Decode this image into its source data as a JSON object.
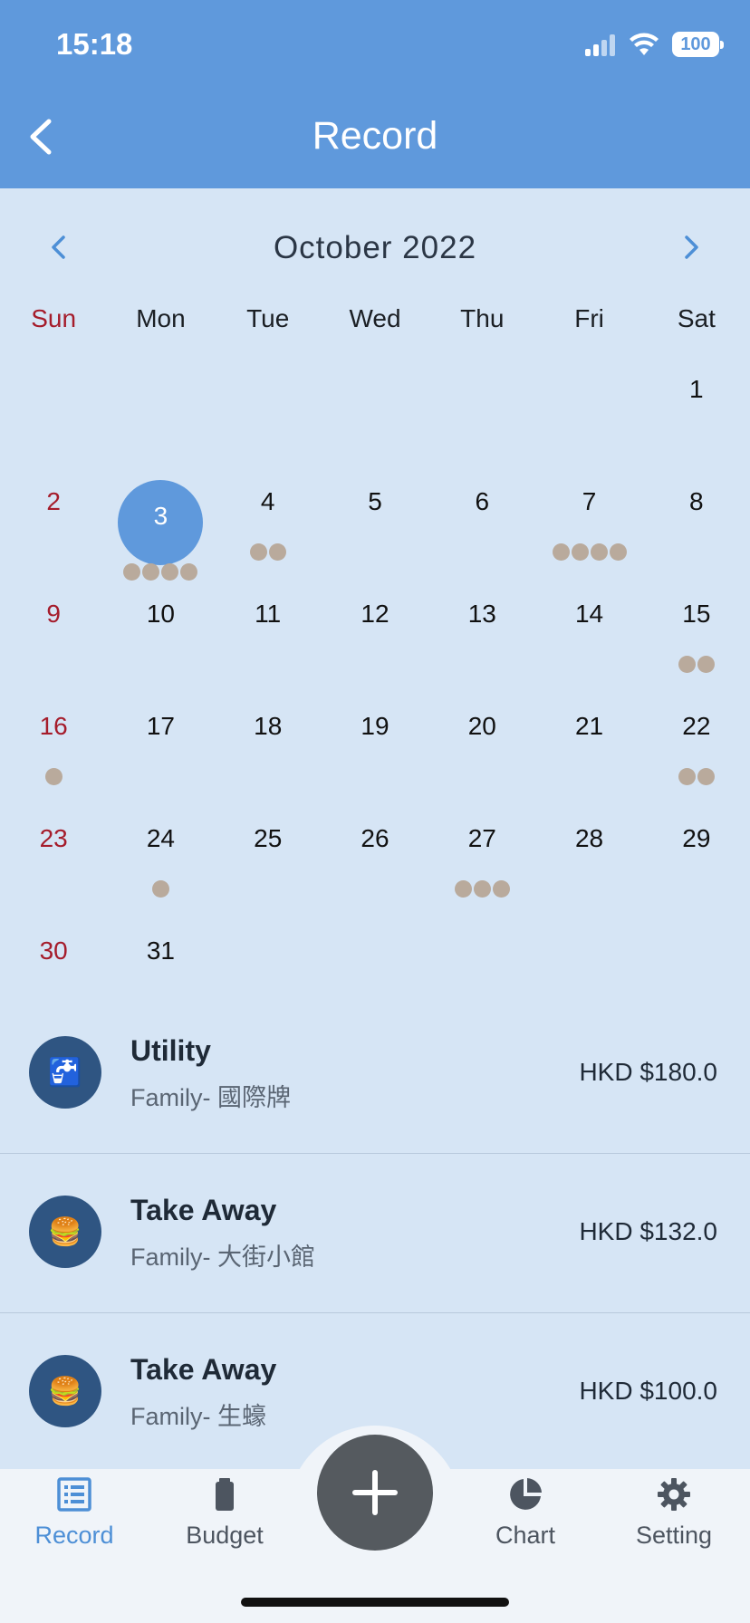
{
  "status_bar": {
    "time": "15:18",
    "battery": "100"
  },
  "header": {
    "title": "Record"
  },
  "calendar": {
    "month_title": "October 2022",
    "weekdays": [
      "Sun",
      "Mon",
      "Tue",
      "Wed",
      "Thu",
      "Fri",
      "Sat"
    ],
    "days": [
      {
        "d": ""
      },
      {
        "d": ""
      },
      {
        "d": ""
      },
      {
        "d": ""
      },
      {
        "d": ""
      },
      {
        "d": ""
      },
      {
        "d": "1"
      },
      {
        "d": "2"
      },
      {
        "d": "3",
        "selected": true,
        "dots": 4
      },
      {
        "d": "4",
        "dots": 2
      },
      {
        "d": "5"
      },
      {
        "d": "6"
      },
      {
        "d": "7",
        "dots": 4
      },
      {
        "d": "8"
      },
      {
        "d": "9"
      },
      {
        "d": "10"
      },
      {
        "d": "11"
      },
      {
        "d": "12"
      },
      {
        "d": "13"
      },
      {
        "d": "14"
      },
      {
        "d": "15",
        "dots": 2
      },
      {
        "d": "16",
        "dots": 1
      },
      {
        "d": "17"
      },
      {
        "d": "18"
      },
      {
        "d": "19"
      },
      {
        "d": "20"
      },
      {
        "d": "21"
      },
      {
        "d": "22",
        "dots": 2
      },
      {
        "d": "23"
      },
      {
        "d": "24",
        "dots": 1
      },
      {
        "d": "25"
      },
      {
        "d": "26"
      },
      {
        "d": "27",
        "dots": 3
      },
      {
        "d": "28"
      },
      {
        "d": "29"
      },
      {
        "d": "30"
      },
      {
        "d": "31"
      }
    ]
  },
  "records": [
    {
      "icon": "faucet-icon",
      "emoji": "🚰",
      "title": "Utility",
      "subtitle": "Family- 國際牌",
      "amount": "HKD $180.0"
    },
    {
      "icon": "burger-icon",
      "emoji": "🍔",
      "title": "Take Away",
      "subtitle": "Family- 大街小館",
      "amount": "HKD $132.0"
    },
    {
      "icon": "burger-icon",
      "emoji": "🍔",
      "title": "Take Away",
      "subtitle": "Family- 生蠔",
      "amount": "HKD $100.0"
    }
  ],
  "tabs": [
    {
      "label": "Record",
      "icon": "list-icon",
      "active": true
    },
    {
      "label": "Budget",
      "icon": "battery-icon"
    },
    {
      "label": "Chart",
      "icon": "pie-chart-icon"
    },
    {
      "label": "Setting",
      "icon": "gear-icon"
    }
  ],
  "colors": {
    "header": "#5f99dc",
    "accent": "#4d8fd6",
    "sunday": "#a51c2b",
    "dot": "#b9aa9c",
    "fab": "#555a5f"
  }
}
